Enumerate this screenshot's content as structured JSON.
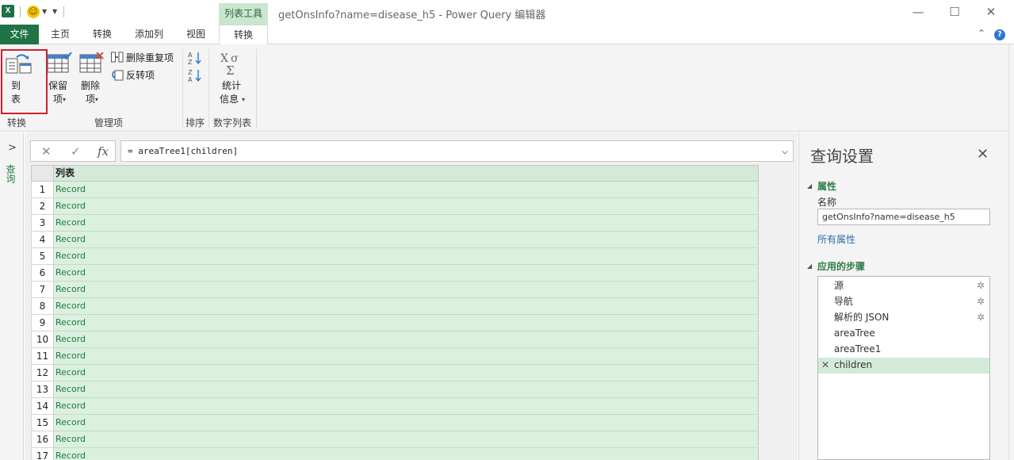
{
  "titlebar": {
    "context_group": "列表工具",
    "window_title": "getOnsInfo?name=disease_h5 - Power Query 编辑器",
    "minimize": "—",
    "maximize": "☐",
    "close": "✕"
  },
  "tabs": [
    "文件",
    "主页",
    "转换",
    "添加列",
    "视图",
    "转换"
  ],
  "ribbon": {
    "to_table": {
      "line1": "到",
      "line2": "表"
    },
    "keep_items": {
      "line1": "保留",
      "line2": "项"
    },
    "remove_items": {
      "line1": "删除",
      "line2": "项"
    },
    "remove_duplicates": "删除重复项",
    "reverse_items": "反转项",
    "statistics": {
      "line1": "统计",
      "line2": "信息"
    },
    "groups": {
      "convert": "转换",
      "manage": "管理项",
      "sort": "排序",
      "numeric_list": "数字列表"
    }
  },
  "left_panel": {
    "label": "查询"
  },
  "formula_bar": {
    "cancel": "✕",
    "confirm": "✓",
    "fx": "fx",
    "formula": "= areaTree1[children]"
  },
  "grid": {
    "column_header": "列表",
    "rows": [
      {
        "n": "1",
        "v": "Record"
      },
      {
        "n": "2",
        "v": "Record"
      },
      {
        "n": "3",
        "v": "Record"
      },
      {
        "n": "4",
        "v": "Record"
      },
      {
        "n": "5",
        "v": "Record"
      },
      {
        "n": "6",
        "v": "Record"
      },
      {
        "n": "7",
        "v": "Record"
      },
      {
        "n": "8",
        "v": "Record"
      },
      {
        "n": "9",
        "v": "Record"
      },
      {
        "n": "10",
        "v": "Record"
      },
      {
        "n": "11",
        "v": "Record"
      },
      {
        "n": "12",
        "v": "Record"
      },
      {
        "n": "13",
        "v": "Record"
      },
      {
        "n": "14",
        "v": "Record"
      },
      {
        "n": "15",
        "v": "Record"
      },
      {
        "n": "16",
        "v": "Record"
      },
      {
        "n": "17",
        "v": "Record"
      }
    ]
  },
  "settings": {
    "title": "查询设置",
    "properties_heading": "属性",
    "name_label": "名称",
    "name_value": "getOnsInfo?name=disease_h5",
    "all_properties": "所有属性",
    "steps_heading": "应用的步骤",
    "steps": [
      {
        "label": "源",
        "gear": true,
        "selected": false
      },
      {
        "label": "导航",
        "gear": true,
        "selected": false
      },
      {
        "label": "解析的 JSON",
        "gear": true,
        "selected": false
      },
      {
        "label": "areaTree",
        "gear": false,
        "selected": false
      },
      {
        "label": "areaTree1",
        "gear": false,
        "selected": false
      },
      {
        "label": "children",
        "gear": false,
        "selected": true
      }
    ]
  },
  "colors": {
    "excel_green": "#217346",
    "context_green": "#cbe6cf",
    "record_green": "#1f7a3c",
    "highlight_red": "#d0202a",
    "section_green": "#2e7d4a"
  }
}
